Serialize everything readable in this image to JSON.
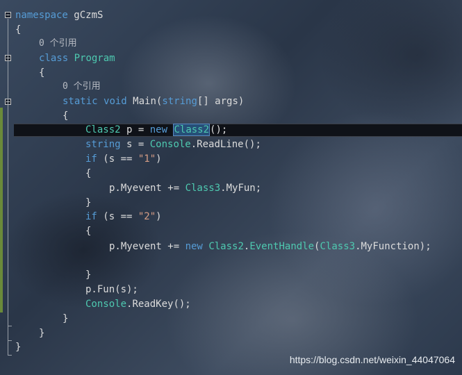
{
  "code": {
    "l1": {
      "kw": "namespace",
      "rest": " gCzmS"
    },
    "l2": "{",
    "l3_hint": "0 个引用",
    "l4": {
      "kw": "class",
      "name": "Program"
    },
    "l5": "{",
    "l6_hint": "0 个引用",
    "l7": {
      "kw1": "static",
      "kw2": "void",
      "name": " Main(",
      "type": "string",
      "rest": "[] args)"
    },
    "l8": "{",
    "l9": {
      "type": "Class2",
      "mid": " p = ",
      "kw": "new",
      "sel": "Class2",
      "rest": "();"
    },
    "l10": {
      "type": "string",
      "mid": " s = ",
      "cls": "Console",
      "rest": ".ReadLine();"
    },
    "l11": {
      "kw": "if",
      "mid": " (s == ",
      "str": "\"1\"",
      "rest": ")"
    },
    "l12": "{",
    "l13": {
      "pre": "p.Myevent += ",
      "cls": "Class3",
      "rest": ".MyFun;"
    },
    "l14": "}",
    "l15": {
      "kw": "if",
      "mid": " (s == ",
      "str": "\"2\"",
      "rest": ")"
    },
    "l16": "{",
    "l17": {
      "pre": "p.Myevent += ",
      "kw": "new",
      "cls": "Class2",
      "dot": ".",
      "ev": "EventHandle",
      "paren": "(",
      "cls2": "Class3",
      "rest": ".MyFunction);"
    },
    "l18": "}",
    "l19": "p.Fun(s);",
    "l20": {
      "cls": "Console",
      "rest": ".ReadKey();"
    },
    "l21": "}",
    "l22": "}",
    "l23": "}"
  },
  "watermark": "https://blog.csdn.net/weixin_44047064",
  "colors": {
    "keyword": "#569cd6",
    "type": "#4ec9b0",
    "string": "#d69d85",
    "text": "#dcdcdc"
  }
}
